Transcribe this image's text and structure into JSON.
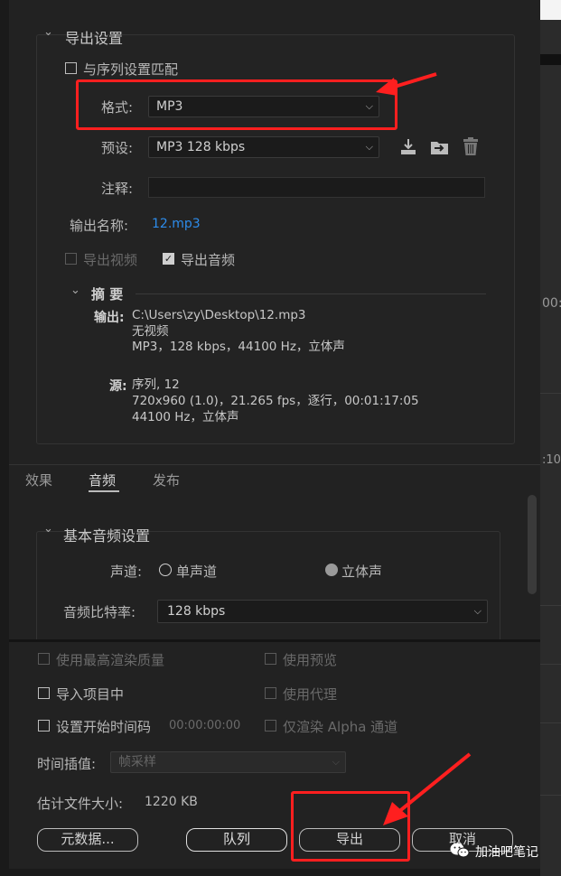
{
  "export_settings": {
    "title": "导出设置",
    "match_sequence": "与序列设置匹配",
    "format_label": "格式:",
    "format_value": "MP3",
    "preset_label": "预设:",
    "preset_value": "MP3 128 kbps",
    "comment_label": "注释:",
    "comment_value": "",
    "output_name_label": "输出名称:",
    "output_name_value": "12.mp3",
    "export_video": "导出视频",
    "export_audio": "导出音频",
    "summary_title": "摘 要",
    "output_label": "输出:",
    "output_lines": [
      "C:\\Users\\zy\\Desktop\\12.mp3",
      "无视频",
      "MP3，128 kbps，44100 Hz，立体声"
    ],
    "source_label": "源:",
    "source_lines": [
      "序列, 12",
      "720x960 (1.0)，21.265 fps，逐行，00:01:17:05",
      "44100 Hz，立体声"
    ]
  },
  "tabs": [
    "效果",
    "音频",
    "发布"
  ],
  "active_tab": "音频",
  "audio": {
    "title": "基本音频设置",
    "channel_label": "声道:",
    "mono": "单声道",
    "stereo": "立体声",
    "bitrate_label": "音频比特率:",
    "bitrate_value": "128 kbps"
  },
  "bottom": {
    "max_render": "使用最高渲染质量",
    "use_previews": "使用预览",
    "import_project": "导入项目中",
    "use_proxies": "使用代理",
    "set_start_tc": "设置开始时间码",
    "start_tc_value": "00:00:00:00",
    "alpha_only": "仅渲染 Alpha 通道",
    "interp_label": "时间插值:",
    "interp_value": "帧采样",
    "est_size_label": "估计文件大小:",
    "est_size_value": "1220 KB"
  },
  "buttons": {
    "metadata": "元数据...",
    "queue": "队列",
    "export": "导出",
    "cancel": "取消"
  },
  "right_strip": [
    "00:",
    ":10"
  ],
  "watermark": "加油吧笔记",
  "colors": {
    "annotation_red": "#ff1f1f",
    "link_blue": "#2d8ceb",
    "panel_bg": "#222222"
  }
}
